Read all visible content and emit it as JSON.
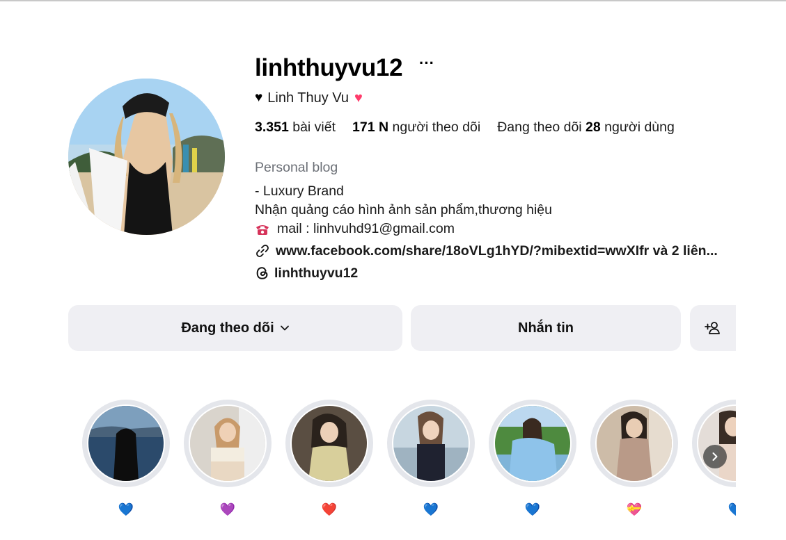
{
  "profile": {
    "username": "linhthuyvu12",
    "more_glyph": "···",
    "full_name": "Linh Thuy Vu",
    "name_prefix_emoji": "♥",
    "name_suffix_emoji": "♥",
    "posts_count": "3.351",
    "posts_label": "bài viết",
    "followers_count": "171 N",
    "followers_label": "người theo dõi",
    "following_prefix": "Đang theo dõi",
    "following_count": "28",
    "following_label": "người dùng",
    "category": "Personal blog",
    "bio_line1": "- Luxury Brand",
    "bio_line2": "Nhận quảng cáo hình ảnh sản phẩm,thương hiệu",
    "bio_line3": "mail : linhvuhd91@gmail.com",
    "link_text": "www.facebook.com/share/18oVLg1hYD/?mibextid=wwXIfr và 2 liên...",
    "threads_handle": "linhthuyvu12"
  },
  "actions": {
    "following_label": "Đang theo dõi",
    "message_label": "Nhắn tin"
  },
  "highlights": [
    {
      "label": "💙",
      "color": "#3b8fd9"
    },
    {
      "label": "💜",
      "color": "#8a3fd9"
    },
    {
      "label": "❤️",
      "color": "#e6283c"
    },
    {
      "label": "💙",
      "color": "#3b8fd9"
    },
    {
      "label": "💙",
      "color": "#3b8fd9"
    },
    {
      "label": "💝",
      "color": "#e6283c"
    },
    {
      "label": "💙",
      "color": "#3b8fd9"
    }
  ],
  "colors": {
    "button_bg": "#efeff3",
    "secondary_text": "#6c7077",
    "ring": "#e4e6eb"
  }
}
